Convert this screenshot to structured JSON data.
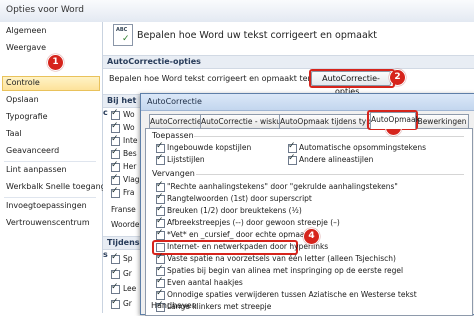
{
  "window": {
    "title": "Opties voor Word"
  },
  "sidebar": {
    "items": [
      {
        "label": "Algemeen"
      },
      {
        "label": "Weergave"
      },
      {
        "label": "Controle"
      },
      {
        "label": "Opslaan"
      },
      {
        "label": "Typografie"
      },
      {
        "label": "Taal"
      },
      {
        "label": "Geavanceerd"
      },
      {
        "label": "Lint aanpassen"
      },
      {
        "label": "Werkbalk Snelle toegang"
      },
      {
        "label": "Invoegtoepassingen"
      },
      {
        "label": "Vertrouwenscentrum"
      }
    ],
    "selected": "Controle"
  },
  "main": {
    "header": "Bepalen hoe Word uw tekst corrigeert en opmaakt",
    "autocorrect_section": "AutoCorrectie-opties",
    "autocorrect_prompt": "Bepalen hoe Word tekst corrigeert en opmaakt terwijl u typt:",
    "autocorrect_button": "AutoCorrectie-opties...",
    "spelling_section": "Bij het c",
    "partial_opts": [
      "Wo",
      "Wo",
      "Inte",
      "Bes",
      "Her",
      "Vlag",
      "Fra"
    ],
    "partial_labels": [
      "Franse",
      "Woordenl"
    ],
    "exceptions_section": "Tijdens s",
    "exc_opts": [
      "Sp",
      "Gr",
      "Lee",
      "Gr"
    ]
  },
  "dialog": {
    "title": "AutoCorrectie",
    "tabs": [
      "AutoCorrectie",
      "AutoCorrectie - wiskundig",
      "AutoOpmaak tijdens typen",
      "AutoOpmaak",
      "Bewerkingen"
    ],
    "active_tab": "AutoOpmaak",
    "apply_group": "Toepassen",
    "apply_options": [
      {
        "label": "Ingebouwde kopstijlen",
        "checked": true
      },
      {
        "label": "Automatische opsommingstekens",
        "checked": true
      },
      {
        "label": "Lijststijlen",
        "checked": true
      },
      {
        "label": "Andere alineastijlen",
        "checked": true
      }
    ],
    "replace_group": "Vervangen",
    "replace_options": [
      {
        "label": "\"Rechte aanhalingstekens\" door \"gekrulde aanhalingstekens\"",
        "checked": true
      },
      {
        "label": "Rangtelwoorden (1st) door superscript",
        "checked": true
      },
      {
        "label": "Breuken (1/2) door breuktekens (½)",
        "checked": true
      },
      {
        "label": "Afbreekstreepjes (--) door gewoon streepje (–)",
        "checked": true
      },
      {
        "label": "*Vet* en _cursief_ door echte opmaak",
        "checked": true
      },
      {
        "label": "Internet- en netwerkpaden door hyperlinks",
        "checked": false
      },
      {
        "label": "Vaste spatie na voorzetsels van één letter (alleen Tsjechisch)",
        "checked": true
      },
      {
        "label": "Spaties bij begin van alinea met inspringing op de eerste regel",
        "checked": true
      },
      {
        "label": "Even aantal haakjes",
        "checked": true
      },
      {
        "label": "Onnodige spaties verwijderen tussen Aziatische en Westerse tekst",
        "checked": true
      },
      {
        "label": "Lange klinkers met streepje",
        "checked": true
      }
    ],
    "keep_group": "Handhaven"
  },
  "badges": [
    "1",
    "2",
    "3",
    "4"
  ],
  "colors": {
    "badge": "#d6241c",
    "selected": "#fde29a",
    "accent": "#283c5a"
  }
}
